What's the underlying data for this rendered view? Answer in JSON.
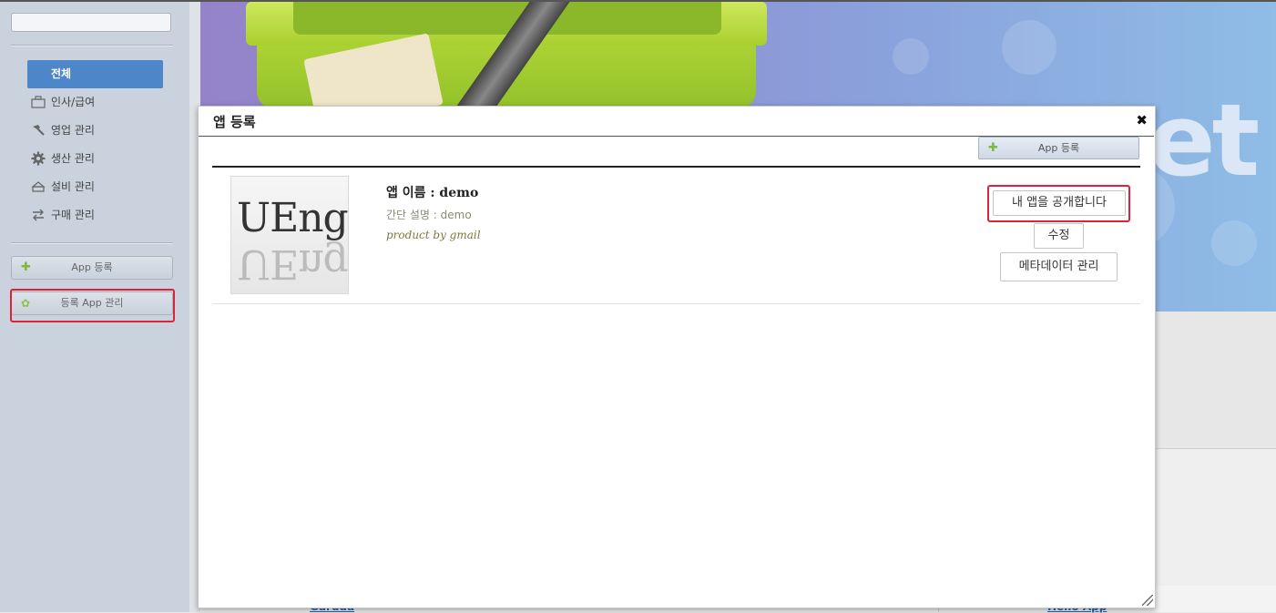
{
  "sidebar": {
    "search_placeholder": "",
    "all_label": "전체",
    "items": [
      {
        "icon": "briefcase-icon",
        "label": "인사/급여"
      },
      {
        "icon": "hammer-icon",
        "label": "영업 관리"
      },
      {
        "icon": "gear-icon",
        "label": "생산 관리"
      },
      {
        "icon": "printer-icon",
        "label": "설비 관리"
      },
      {
        "icon": "swap-arrows-icon",
        "label": "구매 관리"
      }
    ],
    "app_register_label": "App 등록",
    "registered_app_manage_label": "등록 App 관리"
  },
  "background": {
    "bottom_left_link": "Garuda",
    "bottom_right_link": "Hello App"
  },
  "modal": {
    "title": "앱 등록",
    "close_glyph": "✖",
    "register_button_label": "App 등록",
    "app": {
      "thumbnail_logo": "UEngi",
      "name": "앱 이름 : demo",
      "description": "간단 설명 : demo",
      "product": "product by gmail",
      "publish_button_label": "내 앱을 공개합니다",
      "edit_button_label": "수정",
      "metadata_button_label": "메타데이터 관리"
    }
  },
  "colors": {
    "sidebar_bg": "#c9d2dd",
    "selected_item_bg": "#4e87c9",
    "highlight_border": "#d9243b",
    "plus_green": "#7cb83d"
  }
}
